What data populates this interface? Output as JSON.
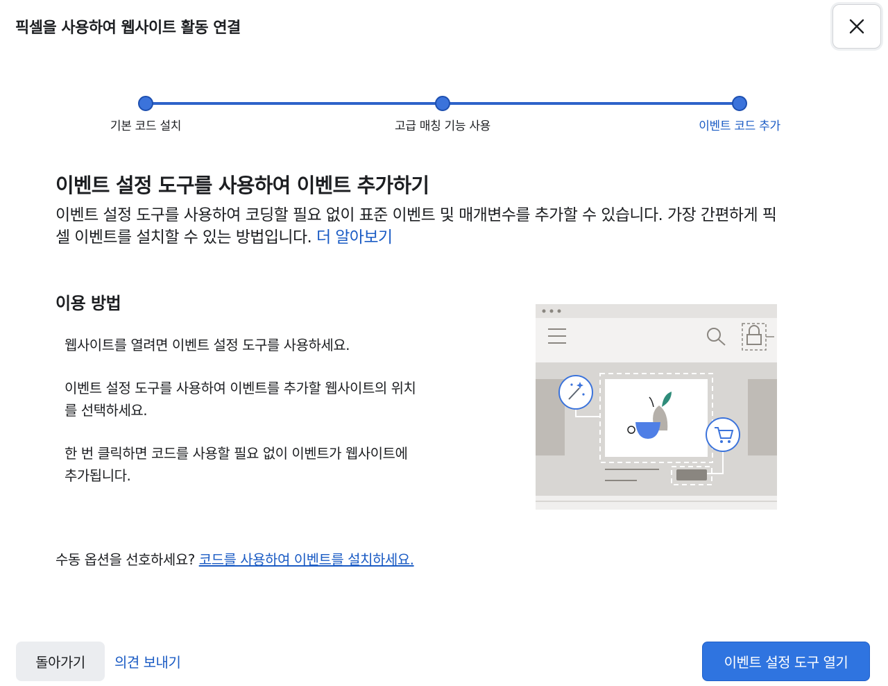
{
  "dialog": {
    "title": "픽셀을 사용하여 웹사이트 활동 연결",
    "close_icon": "close-icon"
  },
  "stepper": {
    "steps": [
      {
        "label": "기본 코드 설치",
        "state": "complete"
      },
      {
        "label": "고급 매칭 기능 사용",
        "state": "complete"
      },
      {
        "label": "이벤트 코드 추가",
        "state": "active"
      }
    ],
    "colors": {
      "line": "#2e63c9",
      "dot": "#3b73db",
      "active_label": "#1a5bc4"
    }
  },
  "main": {
    "title": "이벤트 설정 도구를 사용하여 이벤트 추가하기",
    "description_line1": "이벤트 설정 도구를 사용하여 코딩할 필요 없이 표준 이벤트 및 매개변수를 추가할 수 있습니다. 가장 간편하게 픽",
    "description_line2": "셀 이벤트를 설치할 수 있는 방법입니다.",
    "learn_more": "더 알아보기"
  },
  "howto": {
    "title": "이용 방법",
    "steps": [
      {
        "line1": "웹사이트를 열려면 이벤트 설정 도구를 사용하세요.",
        "line2": ""
      },
      {
        "line1": "이벤트 설정 도구를 사용하여 이벤트를 추가할 웹사이트의 위치",
        "line2": "를 선택하세요."
      },
      {
        "line1": "한 번 클릭하면 코드를 사용할 필요 없이 이벤트가 웹사이트에",
        "line2": "추가됩니다."
      }
    ]
  },
  "illustration": {
    "icons": [
      "menu-icon",
      "search-icon",
      "lock-icon",
      "magic-wand-icon",
      "shopping-cart-icon"
    ]
  },
  "manual": {
    "prompt": "수동 옵션을 선호하세요?",
    "link": "코드를 사용하여 이벤트를 설치하세요."
  },
  "footer": {
    "back_label": "돌아가기",
    "feedback_label": "의견 보내기",
    "primary_label": "이벤트 설정 도구 열기"
  },
  "colors": {
    "primary": "#2f74e0",
    "link": "#1a5bc4",
    "secondary_button": "#ebedf0"
  }
}
